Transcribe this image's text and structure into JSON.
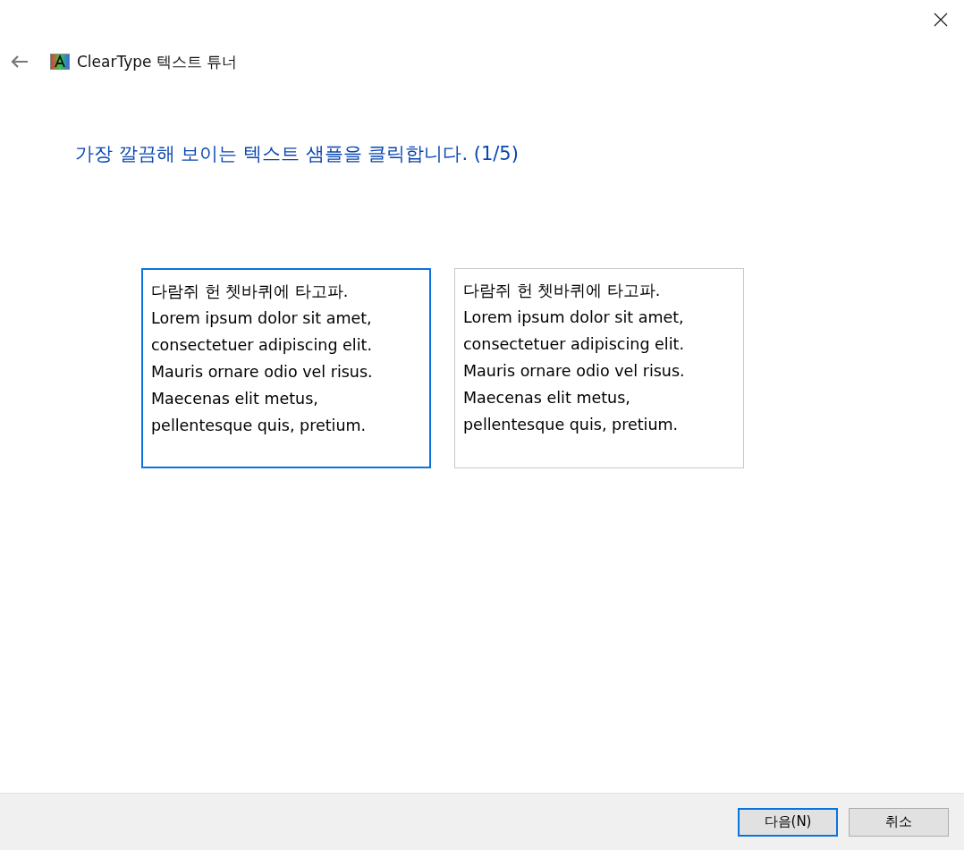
{
  "window": {
    "title": "ClearType 텍스트 튜너"
  },
  "heading": "가장 깔끔해 보이는 텍스트 샘플을 클릭합니다. (1/5)",
  "samples": [
    {
      "selected": true,
      "lines": [
        "다람쥐 헌 쳇바퀴에 타고파.",
        "Lorem ipsum dolor sit amet,",
        "consectetuer adipiscing elit.",
        "Mauris ornare odio vel risus.",
        "Maecenas elit metus,",
        "pellentesque quis, pretium."
      ]
    },
    {
      "selected": false,
      "lines": [
        "다람쥐 헌 쳇바퀴에 타고파.",
        "Lorem ipsum dolor sit amet,",
        "consectetuer adipiscing elit.",
        "Mauris ornare odio vel risus.",
        "Maecenas elit metus,",
        "pellentesque quis, pretium."
      ]
    }
  ],
  "buttons": [
    {
      "label": "다음(N)",
      "default": true
    },
    {
      "label": "취소",
      "default": false
    }
  ]
}
